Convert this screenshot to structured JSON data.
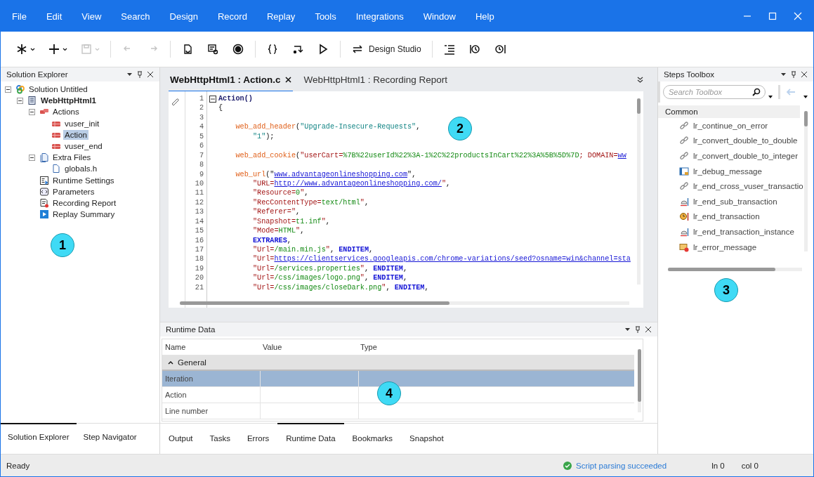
{
  "menu": [
    "File",
    "Edit",
    "View",
    "Search",
    "Design",
    "Record",
    "Replay",
    "Tools",
    "Integrations",
    "Window",
    "Help"
  ],
  "toolbar": [
    {
      "kind": "asterisk",
      "dropdown": true,
      "disabled": false
    },
    {
      "kind": "plus",
      "dropdown": true,
      "disabled": false
    },
    {
      "kind": "save",
      "dropdown": true,
      "disabled": true
    },
    {
      "kind": "sep"
    },
    {
      "kind": "undo",
      "disabled": true
    },
    {
      "kind": "redo",
      "disabled": true
    },
    {
      "kind": "sep"
    },
    {
      "kind": "regenerate",
      "disabled": false
    },
    {
      "kind": "snapshot",
      "disabled": false
    },
    {
      "kind": "record",
      "disabled": false
    },
    {
      "kind": "sep"
    },
    {
      "kind": "braces",
      "disabled": false
    },
    {
      "kind": "step",
      "disabled": false
    },
    {
      "kind": "play",
      "disabled": false
    },
    {
      "kind": "sep"
    },
    {
      "kind": "studio",
      "label": "Design Studio",
      "disabled": false
    },
    {
      "kind": "sep"
    },
    {
      "kind": "outline",
      "disabled": false
    },
    {
      "kind": "history",
      "disabled": false
    },
    {
      "kind": "timer",
      "disabled": false
    }
  ],
  "solution_explorer": {
    "title": "Solution Explorer",
    "callout": "1",
    "tree": [
      {
        "label": "Solution Untitled",
        "kind": "solution",
        "expanded": true,
        "selected": false,
        "children": [
          {
            "label": "WebHttpHtml1",
            "kind": "script",
            "expanded": true,
            "selected": false,
            "children": [
              {
                "label": "Actions",
                "kind": "actions",
                "expanded": true,
                "selected": false,
                "children": [
                  {
                    "label": "vuser_init",
                    "kind": "action",
                    "selected": false
                  },
                  {
                    "label": "Action",
                    "kind": "action",
                    "selected": true
                  },
                  {
                    "label": "vuser_end",
                    "kind": "action",
                    "selected": false
                  }
                ]
              },
              {
                "label": "Extra Files",
                "kind": "files",
                "expanded": true,
                "selected": false,
                "children": [
                  {
                    "label": "globals.h",
                    "kind": "file",
                    "selected": false
                  }
                ]
              },
              {
                "label": "Runtime Settings",
                "kind": "settings",
                "selected": false
              },
              {
                "label": "Parameters",
                "kind": "parameters",
                "selected": false
              },
              {
                "label": "Recording Report",
                "kind": "report",
                "selected": false
              },
              {
                "label": "Replay Summary",
                "kind": "summary",
                "selected": false
              }
            ]
          }
        ]
      }
    ],
    "bottom_tabs": [
      {
        "label": "Solution Explorer",
        "selected": true
      },
      {
        "label": "Step Navigator",
        "selected": false
      }
    ]
  },
  "editor": {
    "callout": "2",
    "tabs": [
      {
        "label": "WebHttpHtml1 : Action.c",
        "selected": true,
        "closable": true
      },
      {
        "label": "WebHttpHtml1 : Recording Report",
        "selected": false
      }
    ],
    "lines": [
      {
        "number": "1",
        "fold": true,
        "tokens": [
          {
            "kind": "def",
            "text": "Action()"
          }
        ]
      },
      {
        "number": "2",
        "tokens": [
          {
            "kind": "plain",
            "text": "{"
          }
        ]
      },
      {
        "number": "3"
      },
      {
        "number": "4",
        "tokens": [
          {
            "kind": "fn",
            "text": "    web_add_header"
          },
          {
            "kind": "plain",
            "text": "("
          },
          {
            "kind": "str",
            "text": "\"Upgrade-Insecure-Requests\""
          },
          {
            "kind": "plain",
            "text": ","
          }
        ]
      },
      {
        "number": "5",
        "tokens": [
          {
            "kind": "str",
            "text": "        \"1\""
          },
          {
            "kind": "plain",
            "text": ");"
          }
        ]
      },
      {
        "number": "6"
      },
      {
        "number": "7",
        "tokens": [
          {
            "kind": "fn",
            "text": "    web_add_cookie"
          },
          {
            "kind": "plain",
            "text": "("
          },
          {
            "kind": "key",
            "text": "\"userCart="
          },
          {
            "kind": "val",
            "text": "%7B%22userId%22%3A-1%2C%22productsInCart%22%3A%5B%5D%7D"
          },
          {
            "kind": "key",
            "text": "; DOMAIN="
          },
          {
            "kind": "link",
            "text": "ww"
          }
        ]
      },
      {
        "number": "8"
      },
      {
        "number": "9",
        "tokens": [
          {
            "kind": "fn",
            "text": "    web_url"
          },
          {
            "kind": "plain",
            "text": "(\""
          },
          {
            "kind": "link",
            "text": "www.advantageonlineshopping.com"
          },
          {
            "kind": "plain",
            "text": "\","
          }
        ]
      },
      {
        "number": "10",
        "tokens": [
          {
            "kind": "key",
            "text": "        \"URL="
          },
          {
            "kind": "link",
            "text": "http://www.advantageonlineshopping.com/"
          },
          {
            "kind": "key",
            "text": "\""
          },
          {
            "kind": "plain",
            "text": ","
          }
        ]
      },
      {
        "number": "11",
        "tokens": [
          {
            "kind": "key",
            "text": "        \"Resource="
          },
          {
            "kind": "val",
            "text": "0"
          },
          {
            "kind": "key",
            "text": "\""
          },
          {
            "kind": "plain",
            "text": ","
          }
        ]
      },
      {
        "number": "12",
        "tokens": [
          {
            "kind": "key",
            "text": "        \"RecContentType="
          },
          {
            "kind": "val",
            "text": "text/html"
          },
          {
            "kind": "key",
            "text": "\""
          },
          {
            "kind": "plain",
            "text": ","
          }
        ]
      },
      {
        "number": "13",
        "tokens": [
          {
            "kind": "key",
            "text": "        \"Referer=\""
          },
          {
            "kind": "plain",
            "text": ","
          }
        ]
      },
      {
        "number": "14",
        "tokens": [
          {
            "kind": "key",
            "text": "        \"Snapshot="
          },
          {
            "kind": "val",
            "text": "t1.inf"
          },
          {
            "kind": "key",
            "text": "\""
          },
          {
            "kind": "plain",
            "text": ","
          }
        ]
      },
      {
        "number": "15",
        "tokens": [
          {
            "kind": "key",
            "text": "        \"Mode="
          },
          {
            "kind": "val",
            "text": "HTML"
          },
          {
            "kind": "key",
            "text": "\""
          },
          {
            "kind": "plain",
            "text": ","
          }
        ]
      },
      {
        "number": "16",
        "tokens": [
          {
            "kind": "kw",
            "text": "        EXTRARES"
          },
          {
            "kind": "plain",
            "text": ","
          }
        ]
      },
      {
        "number": "17",
        "tokens": [
          {
            "kind": "key",
            "text": "        \"Url="
          },
          {
            "kind": "val",
            "text": "/main.min.js"
          },
          {
            "kind": "key",
            "text": "\""
          },
          {
            "kind": "plain",
            "text": ", "
          },
          {
            "kind": "kw",
            "text": "ENDITEM"
          },
          {
            "kind": "plain",
            "text": ","
          }
        ]
      },
      {
        "number": "18",
        "tokens": [
          {
            "kind": "key",
            "text": "        \"Url="
          },
          {
            "kind": "link",
            "text": "https://clientservices.googleapis.com/chrome-variations/seed?osname=win&channel=sta"
          }
        ]
      },
      {
        "number": "19",
        "tokens": [
          {
            "kind": "key",
            "text": "        \"Url="
          },
          {
            "kind": "val",
            "text": "/services.properties"
          },
          {
            "kind": "key",
            "text": "\""
          },
          {
            "kind": "plain",
            "text": ", "
          },
          {
            "kind": "kw",
            "text": "ENDITEM"
          },
          {
            "kind": "plain",
            "text": ","
          }
        ]
      },
      {
        "number": "20",
        "tokens": [
          {
            "kind": "key",
            "text": "        \"Url="
          },
          {
            "kind": "val",
            "text": "/css/images/logo.png"
          },
          {
            "kind": "key",
            "text": "\""
          },
          {
            "kind": "plain",
            "text": ", "
          },
          {
            "kind": "kw",
            "text": "ENDITEM"
          },
          {
            "kind": "plain",
            "text": ","
          }
        ]
      },
      {
        "number": "21",
        "tokens": [
          {
            "kind": "key",
            "text": "        \"Url="
          },
          {
            "kind": "val",
            "text": "/css/images/closeDark.png"
          },
          {
            "kind": "key",
            "text": "\""
          },
          {
            "kind": "plain",
            "text": ", "
          },
          {
            "kind": "kw",
            "text": "ENDITEM"
          },
          {
            "kind": "plain",
            "text": ","
          }
        ]
      }
    ]
  },
  "runtime_data": {
    "title": "Runtime Data",
    "callout": "4",
    "columns": [
      "Name",
      "Value",
      "Type"
    ],
    "groups": [
      {
        "label": "General",
        "expanded": true,
        "rows": [
          {
            "name": "Iteration",
            "selected": true
          },
          {
            "name": "Action",
            "selected": false
          },
          {
            "name": "Line number",
            "selected": false
          }
        ]
      }
    ]
  },
  "output_tabs": [
    {
      "label": "Output",
      "selected": false
    },
    {
      "label": "Tasks",
      "selected": false
    },
    {
      "label": "Errors",
      "selected": false
    },
    {
      "label": "Runtime Data",
      "selected": true
    },
    {
      "label": "Bookmarks",
      "selected": false
    },
    {
      "label": "Snapshot",
      "selected": false
    }
  ],
  "steps_toolbox": {
    "title": "Steps Toolbox",
    "callout": "3",
    "search": {
      "placeholder": "Search Toolbox"
    },
    "group": "Common",
    "items": [
      {
        "label": "lr_continue_on_error",
        "kind": "link"
      },
      {
        "label": "lr_convert_double_to_double",
        "kind": "link"
      },
      {
        "label": "lr_convert_double_to_integer",
        "kind": "link"
      },
      {
        "label": "lr_debug_message",
        "kind": "debug"
      },
      {
        "label": "lr_end_cross_vuser_transactio",
        "kind": "link"
      },
      {
        "label": "lr_end_sub_transaction",
        "kind": "bell"
      },
      {
        "label": "lr_end_transaction",
        "kind": "clock"
      },
      {
        "label": "lr_end_transaction_instance",
        "kind": "bell"
      },
      {
        "label": "lr_error_message",
        "kind": "error"
      }
    ]
  },
  "status_bar": {
    "state": "Ready",
    "message": "Script parsing succeeded",
    "line": "ln 0",
    "column": "col 0"
  }
}
